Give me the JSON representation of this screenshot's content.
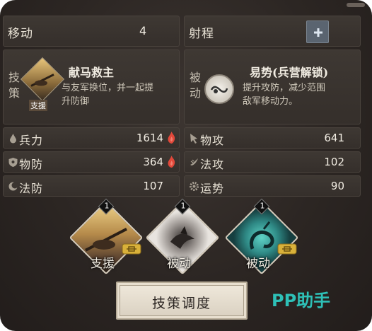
{
  "top": {
    "move_label": "移动",
    "move_value": "4",
    "range_label": "射程",
    "range_button_icon": "plus-icon"
  },
  "skills": {
    "left": {
      "side_label": "技策",
      "title": "献马救主",
      "desc_line1": "与友军换位，并一起提",
      "desc_line2": "升防御",
      "badge": "支援"
    },
    "right": {
      "side_label": "被动",
      "title": "易势(兵营解锁)",
      "desc_line1": "提升攻防，减少范围",
      "desc_line2": "敌军移动力。"
    }
  },
  "stats": [
    {
      "label": "兵力",
      "value": "1614",
      "icon": "droplet-icon",
      "flame": true
    },
    {
      "label": "物攻",
      "value": "641",
      "icon": "arrow-icon",
      "flame": false
    },
    {
      "label": "物防",
      "value": "364",
      "icon": "shield-icon",
      "flame": true
    },
    {
      "label": "法攻",
      "value": "102",
      "icon": "wind-icon",
      "flame": false
    },
    {
      "label": "法防",
      "value": "107",
      "icon": "moon-icon",
      "flame": false
    },
    {
      "label": "运势",
      "value": "90",
      "icon": "gear-icon",
      "flame": false
    }
  ],
  "slots": [
    {
      "label": "支援",
      "level": "1"
    },
    {
      "label": "被动",
      "level": "1"
    },
    {
      "label": "被动",
      "level": "1"
    }
  ],
  "button": {
    "label": "技策调度"
  },
  "watermark": "PP助手",
  "colors": {
    "flame": "#e2483a",
    "teal_watermark": "#2ec0b7",
    "gold": "#d9b13a"
  }
}
